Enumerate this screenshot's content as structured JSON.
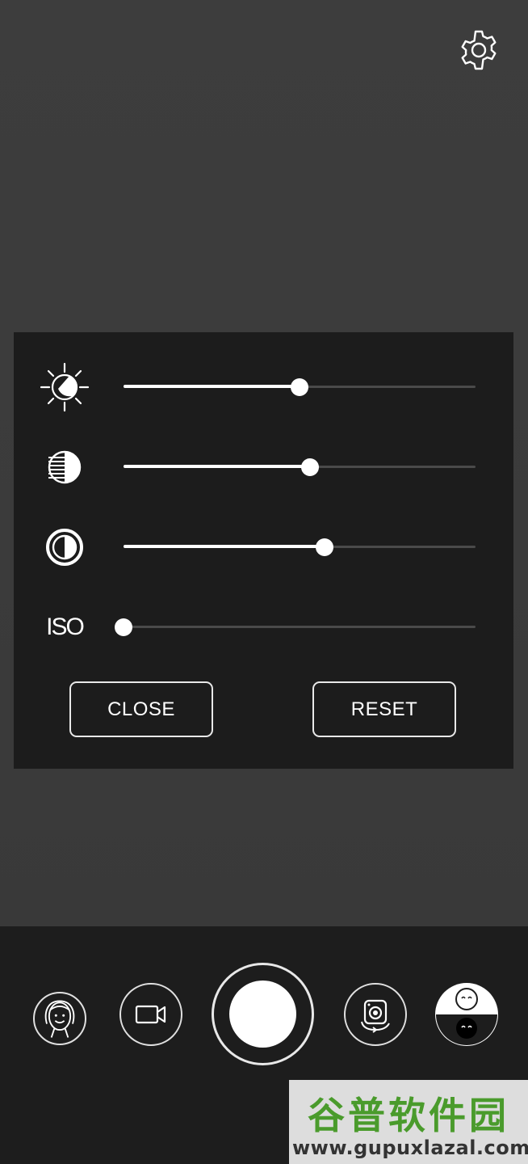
{
  "panel": {
    "sliders": [
      {
        "name": "brightness",
        "icon": "brightness-icon",
        "value": 0.5
      },
      {
        "name": "exposure",
        "icon": "exposure-icon",
        "value": 0.53
      },
      {
        "name": "contrast",
        "icon": "contrast-icon",
        "value": 0.57
      },
      {
        "name": "iso",
        "icon": "iso-label",
        "label": "ISO",
        "value": 0.0
      }
    ],
    "close_label": "CLOSE",
    "reset_label": "RESET"
  },
  "toolbar": {
    "modes": [
      "face-mode-icon",
      "video-icon",
      "shutter-button",
      "switch-camera-icon",
      "dual-face-icon"
    ]
  },
  "watermark": {
    "title": "谷普软件园",
    "url": "www.gupuxlazal.com"
  }
}
